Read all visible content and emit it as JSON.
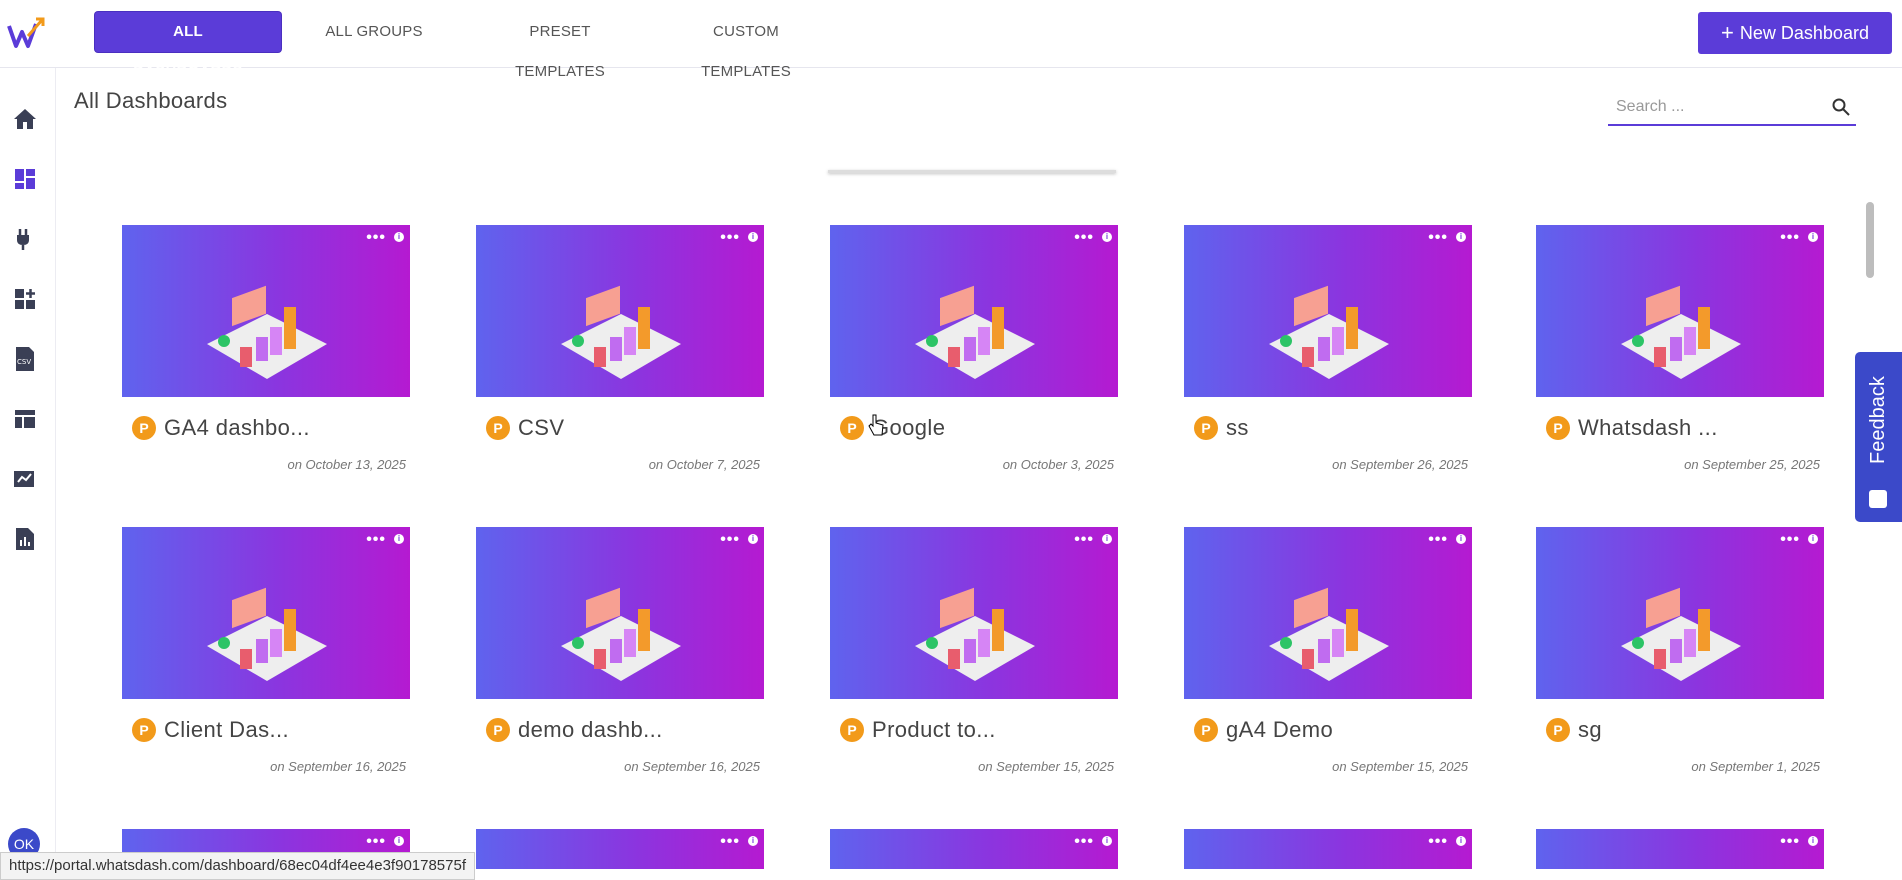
{
  "top_tabs": [
    {
      "label": "ALL DASHBOARDS",
      "active": true
    },
    {
      "label": "ALL GROUPS",
      "active": false
    },
    {
      "label": "PRESET TEMPLATES",
      "active": false
    },
    {
      "label": "CUSTOM TEMPLATES",
      "active": false
    }
  ],
  "new_button": {
    "label": "New Dashboard"
  },
  "page": {
    "title": "All Dashboards"
  },
  "search": {
    "placeholder": "Search ..."
  },
  "feedback": {
    "label": "Feedback"
  },
  "ok_badge": "OK",
  "status_url": "https://portal.whatsdash.com/dashboard/68ec04df4ee4e3f90178575f",
  "dashboards": [
    {
      "title": "GA4 dashbo...",
      "date": "on October 13, 2025"
    },
    {
      "title": "CSV",
      "date": "on October 7, 2025"
    },
    {
      "title": "Google",
      "date": "on October 3, 2025"
    },
    {
      "title": "ss",
      "date": "on September 26, 2025"
    },
    {
      "title": "Whatsdash ...",
      "date": "on September 25, 2025"
    },
    {
      "title": "Client Das...",
      "date": "on September 16, 2025"
    },
    {
      "title": "demo dashb...",
      "date": "on September 16, 2025"
    },
    {
      "title": "Product to...",
      "date": "on September 15, 2025"
    },
    {
      "title": "gA4 Demo",
      "date": "on September 15, 2025"
    },
    {
      "title": "sg",
      "date": "on September 1, 2025"
    }
  ],
  "badge_letter": "P",
  "sidebar_icons": [
    "home-icon",
    "dashboard-icon",
    "plug-icon",
    "add-widget-icon",
    "csv-icon",
    "layout-icon",
    "reports-icon",
    "analytics-icon"
  ],
  "colors": {
    "accent": "#5b3cd8",
    "badge": "#f29a1a",
    "feedback": "#3b49c9"
  }
}
